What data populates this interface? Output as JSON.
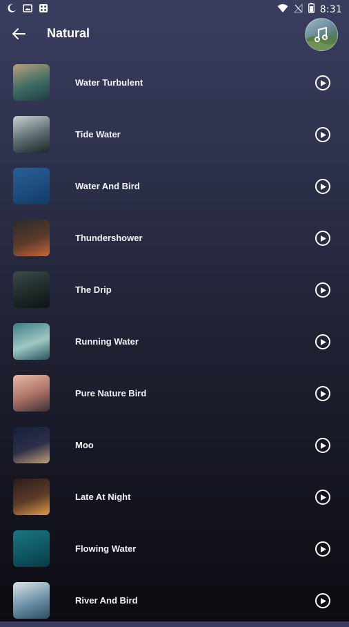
{
  "status_bar": {
    "time": "8:31",
    "left_icons": [
      "moon-icon",
      "image-icon",
      "grid-app-icon"
    ],
    "right_icons": [
      "wifi-icon",
      "no-signal-icon",
      "battery-icon"
    ]
  },
  "header": {
    "title": "Natural",
    "back_icon": "arrow-left-icon",
    "avatar_icon": "music-note-icon"
  },
  "sounds": [
    {
      "title": "Water Turbulent",
      "colors": [
        "#b9a07c",
        "#3f6b62",
        "#1f3c44"
      ]
    },
    {
      "title": "Tide Water",
      "colors": [
        "#c9d0cf",
        "#5a6b6e",
        "#1d2629"
      ]
    },
    {
      "title": "Water And Bird",
      "colors": [
        "#2a5f93",
        "#1c4c80",
        "#113a66"
      ]
    },
    {
      "title": "Thundershower",
      "colors": [
        "#2b2a2a",
        "#5a3a2a",
        "#c9673a"
      ]
    },
    {
      "title": "The Drip",
      "colors": [
        "#3c4a48",
        "#1f2a29",
        "#0e1414"
      ]
    },
    {
      "title": "Running Water",
      "colors": [
        "#3f7d86",
        "#9fc7c4",
        "#24565e"
      ]
    },
    {
      "title": "Pure Nature Bird",
      "colors": [
        "#e8b9a3",
        "#a97065",
        "#3a2e35"
      ]
    },
    {
      "title": "Moo",
      "colors": [
        "#14203a",
        "#2d2f4a",
        "#c4a276"
      ]
    },
    {
      "title": "Late At Night",
      "colors": [
        "#2a1c18",
        "#5c3c2a",
        "#e19a45"
      ]
    },
    {
      "title": "Flowing Water",
      "colors": [
        "#1b7780",
        "#0e5763",
        "#0a3a44"
      ]
    },
    {
      "title": "River And Bird",
      "colors": [
        "#d8e4ea",
        "#6d8fa5",
        "#2c4f64"
      ]
    }
  ],
  "play_icon": "play-circle-icon",
  "colors": {
    "background_top": "#3a3d5e",
    "background_bottom": "#0b0b10",
    "text": "#ffffff"
  }
}
